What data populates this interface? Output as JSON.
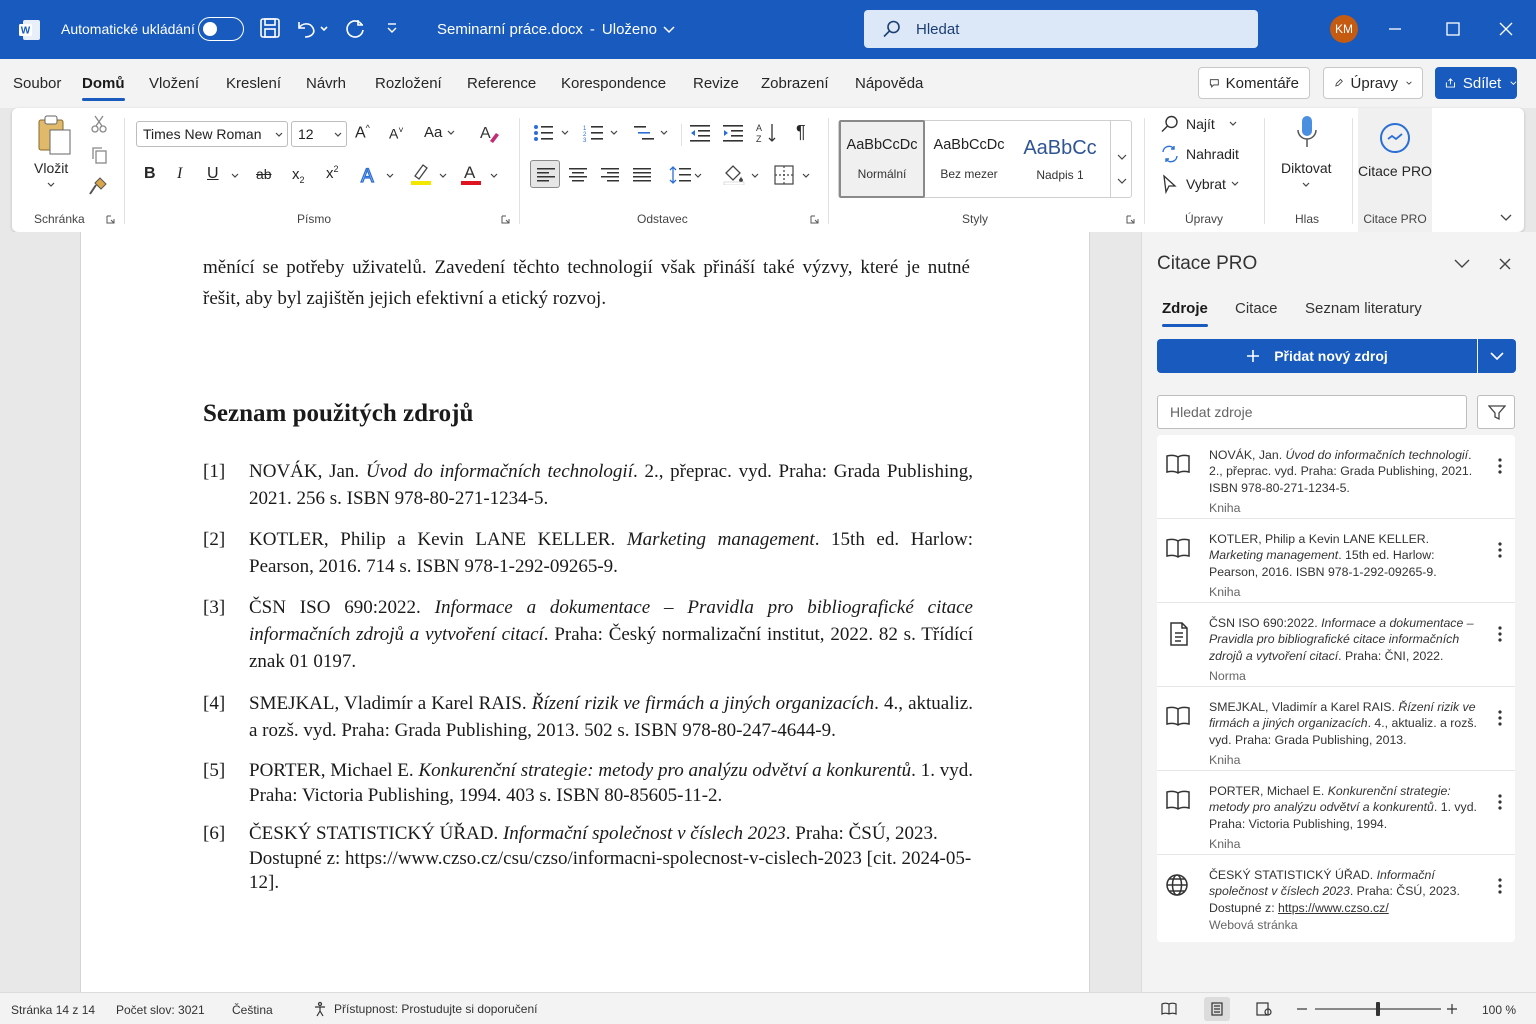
{
  "titlebar": {
    "autosave_label": "Automatické ukládání",
    "doc_title": "Seminarní práce.docx",
    "save_state": "Uloženo",
    "search_placeholder": "Hledat",
    "user_initials": "KM",
    "app_icon": "word-icon"
  },
  "menu": {
    "tabs": [
      "Soubor",
      "Domů",
      "Vložení",
      "Kreslení",
      "Návrh",
      "Rozložení",
      "Reference",
      "Korespondence",
      "Revize",
      "Zobrazení",
      "Nápověda"
    ],
    "active_tab": "Domů",
    "comments_label": "Komentáře",
    "edit_label": "Úpravy",
    "share_label": "Sdílet"
  },
  "ribbon": {
    "clipboard": {
      "paste_label": "Vložit",
      "group_label": "Schránka"
    },
    "font": {
      "font_name": "Times New Roman",
      "font_size": "12",
      "group_label": "Písmo",
      "case_label": "Aa"
    },
    "paragraph": {
      "group_label": "Odstavec"
    },
    "styles": {
      "items": [
        {
          "preview": "AaBbCcDc",
          "name": "Normální"
        },
        {
          "preview": "AaBbCcDc",
          "name": "Bez mezer"
        },
        {
          "preview": "AaBbCc",
          "name": "Nadpis 1"
        }
      ],
      "group_label": "Styly"
    },
    "editing": {
      "find": "Najít",
      "replace": "Nahradit",
      "select": "Vybrat",
      "group_label": "Úpravy"
    },
    "voice": {
      "dictate": "Diktovat",
      "group_label": "Hlas"
    },
    "citace": {
      "label": "Citace PRO",
      "group_label": "Citace PRO"
    },
    "accent_color": "#185abd"
  },
  "document": {
    "intro_text": "měnící se potřeby uživatelů. Zavedení těchto technologií však přináší také výzvy, které je nutné řešit, aby byl zajištěn jejich efektivní a etický rozvoj.",
    "heading": "Seznam použitých zdrojů",
    "references": [
      {
        "num": "[1]",
        "before": "NOVÁK, Jan. ",
        "italic": "Úvod do informačních technologií",
        "after": ". 2., přeprac. vyd. Praha: Grada Publishing, 2021. 256 s. ISBN 978-80-271-1234-5."
      },
      {
        "num": "[2]",
        "before": "KOTLER, Philip a Kevin LANE KELLER. ",
        "italic": "Marketing management",
        "after": ". 15th ed. Harlow: Pearson, 2016. 714 s. ISBN 978-1-292-09265-9."
      },
      {
        "num": "[3]",
        "before": "ČSN ISO 690:2022. ",
        "italic": "Informace a dokumentace – Pravidla pro bibliografické citace informačních zdrojů a vytvoření citací",
        "after": ". Praha: Český normalizační institut, 2022. 82 s. Třídící znak 01 0197."
      },
      {
        "num": "[4]",
        "before": "SMEJKAL, Vladimír a Karel RAIS. ",
        "italic": "Řízení rizik ve firmách a jiných organizacích",
        "after": ". 4., aktualiz. a rozš. vyd. Praha: Grada Publishing, 2013. 502 s. ISBN 978-80-247-4644-9."
      },
      {
        "num": "[5]",
        "before": "PORTER, Michael E. ",
        "italic": "Konkurenční strategie: metody pro analýzu odvětví a konkurentů",
        "after": ". 1. vyd. Praha: Victoria Publishing, 1994. 403 s. ISBN 80-85605-11-2."
      },
      {
        "num": "[6]",
        "before": "ČESKÝ STATISTICKÝ ÚŘAD. ",
        "italic": "Informační společnost v číslech 2023",
        "after": ". Praha: ČSÚ, 2023. Dostupné z: https://www.czso.cz/csu/czso/informacni-spolecnost-v-cislech-2023 [cit. 2024-05-12]."
      }
    ]
  },
  "pane": {
    "title": "Citace PRO",
    "tabs": [
      "Zdroje",
      "Citace",
      "Seznam literatury"
    ],
    "active_tab": "Zdroje",
    "add_button": "Přidat nový zdroj",
    "search_placeholder": "Hledat zdroje",
    "sources": [
      {
        "icon": "book-icon",
        "before": "NOVÁK, Jan. ",
        "italic": "Úvod do informačních technologií",
        "after": ". 2., přeprac. vyd. Praha: Grada Publishing, 2021. ISBN 978-80-271-1234-5.",
        "link": "",
        "type": "Kniha"
      },
      {
        "icon": "book-icon",
        "before": "KOTLER, Philip a Kevin LANE KELLER. ",
        "italic": "Marketing management",
        "after": ". 15th ed. Harlow: Pearson, 2016. ISBN 978-1-292-09265-9.",
        "link": "",
        "type": "Kniha"
      },
      {
        "icon": "document-icon",
        "before": "ČSN ISO 690:2022. ",
        "italic": "Informace a dokumentace – Pravidla pro bibliografické citace informačních zdrojů a vytvoření citací",
        "after": ". Praha: ČNI, 2022.",
        "link": "",
        "type": "Norma"
      },
      {
        "icon": "book-icon",
        "before": "SMEJKAL, Vladimír a Karel RAIS. ",
        "italic": "Řízení rizik ve firmách a jiných organizacích",
        "after": ". 4., aktualiz. a rozš. vyd. Praha: Grada Publishing, 2013.",
        "link": "",
        "type": "Kniha"
      },
      {
        "icon": "book-icon",
        "before": "PORTER, Michael E. ",
        "italic": "Konkurenční strategie: metody pro analýzu odvětví a konkurentů",
        "after": ". 1. vyd. Praha: Victoria Publishing, 1994.",
        "link": "",
        "type": "Kniha"
      },
      {
        "icon": "globe-icon",
        "before": "ČESKÝ STATISTICKÝ ÚŘAD. ",
        "italic": "Informační společnost v číslech 2023",
        "after": ". Praha: ČSÚ, 2023. Dostupné z: ",
        "link": "https://www.czso.cz/",
        "type": "Webová stránka"
      }
    ]
  },
  "status": {
    "page": "Stránka 14 z 14",
    "words": "Počet slov: 3021",
    "language": "Čeština",
    "accessibility": "Přístupnost: Prostudujte si doporučení",
    "zoom": "100 %",
    "zoom_fraction": 0.5
  }
}
